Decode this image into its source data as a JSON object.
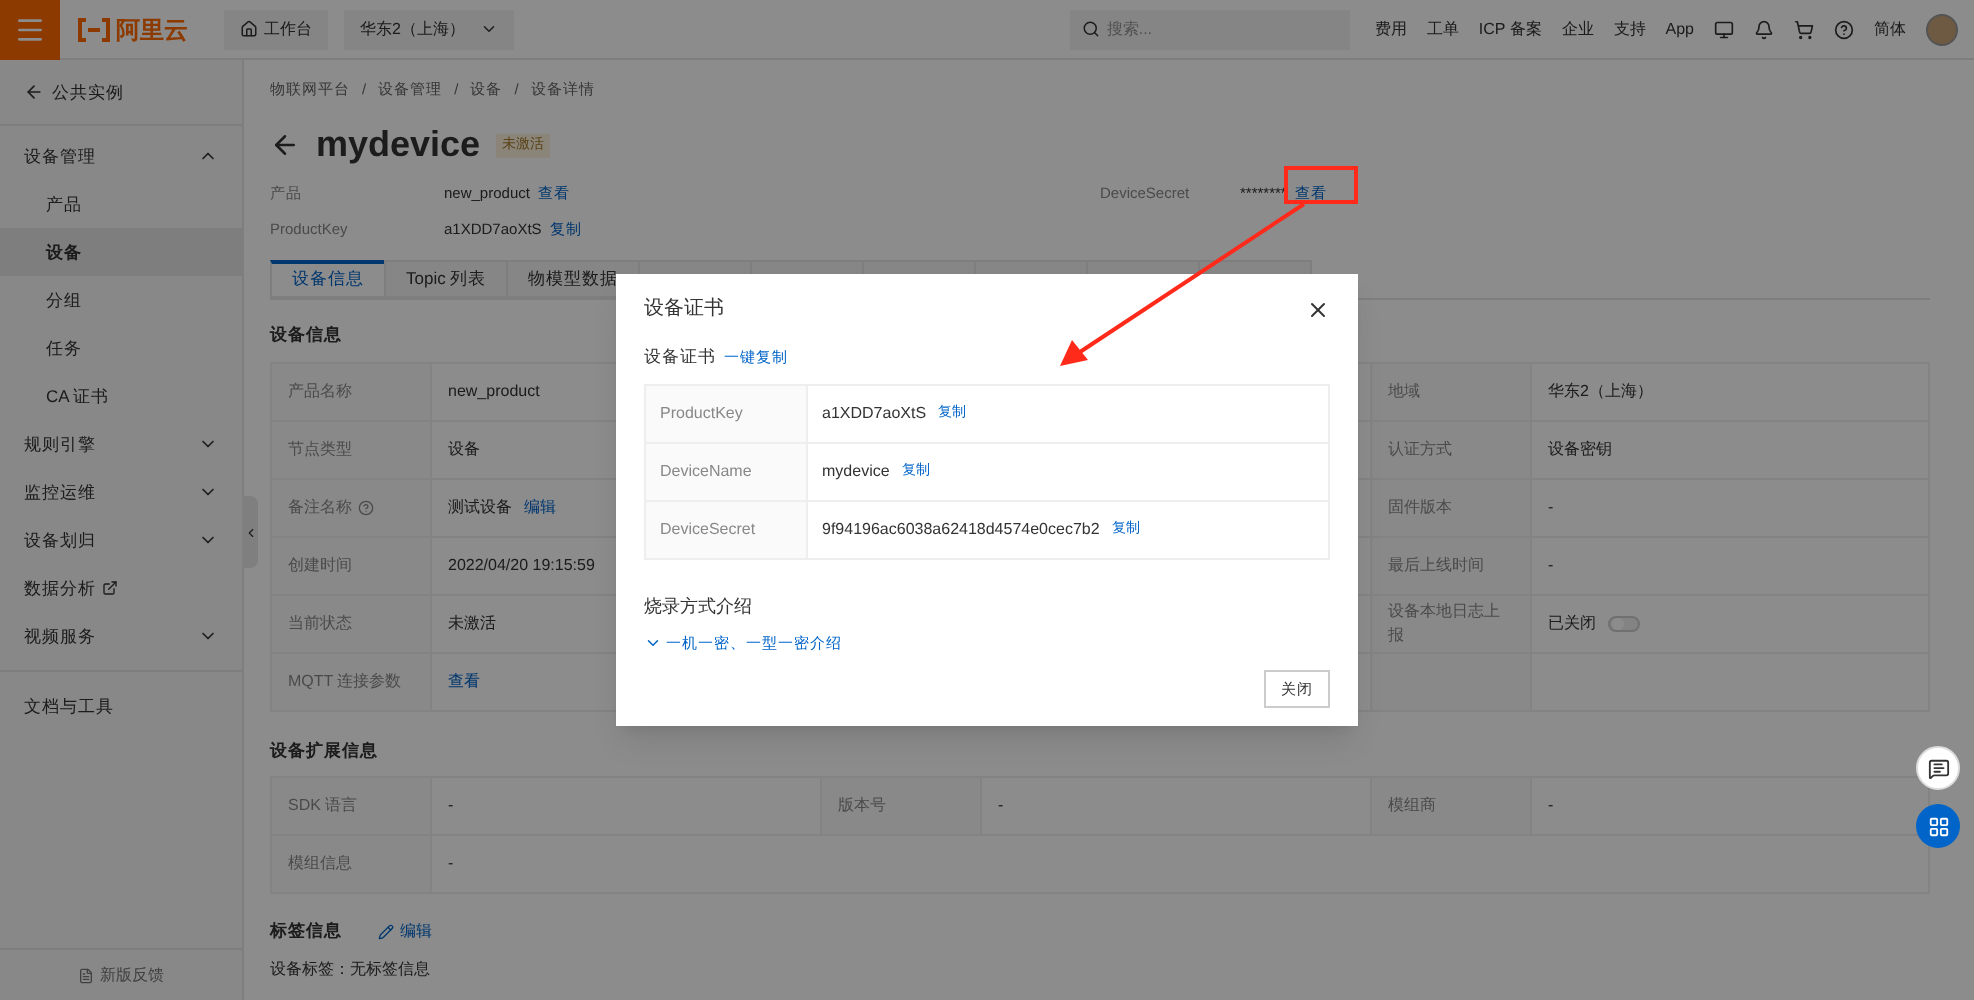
{
  "topbar": {
    "brand": "阿里云",
    "workbench": "工作台",
    "region": "华东2（上海）",
    "search": {
      "placeholder": "搜索..."
    },
    "links": [
      "费用",
      "工单",
      "ICP 备案",
      "企业",
      "支持",
      "App"
    ],
    "language": "简体"
  },
  "sidebar": {
    "back": "公共实例",
    "items": [
      {
        "label": "设备管理",
        "kind": "group",
        "expanded": true,
        "children": [
          {
            "label": "产品",
            "selected": false
          },
          {
            "label": "设备",
            "selected": true
          },
          {
            "label": "分组",
            "selected": false
          },
          {
            "label": "任务",
            "selected": false
          },
          {
            "label": "CA 证书",
            "selected": false
          }
        ]
      },
      {
        "label": "规则引擎",
        "kind": "group",
        "expanded": false
      },
      {
        "label": "监控运维",
        "kind": "group",
        "expanded": false
      },
      {
        "label": "设备划归",
        "kind": "group",
        "expanded": false
      },
      {
        "label": "数据分析",
        "kind": "external"
      },
      {
        "label": "视频服务",
        "kind": "group",
        "expanded": false
      },
      {
        "label": "文档与工具",
        "kind": "link"
      }
    ],
    "feedback": "新版反馈"
  },
  "breadcrumb": {
    "separator": "/",
    "items": [
      "物联网平台",
      "设备管理",
      "设备",
      "设备详情"
    ]
  },
  "device": {
    "name": "mydevice",
    "status": "未激活",
    "meta": [
      {
        "label": "产品",
        "value": "new_product",
        "action": "查看"
      },
      {
        "label": "ProductKey",
        "value": "a1XDD7aoXtS",
        "action": "复制"
      }
    ],
    "secret": {
      "label": "DeviceSecret",
      "value": "********",
      "action": "查看"
    }
  },
  "tabs": [
    {
      "label": "设备信息",
      "selected": true
    },
    {
      "label": "Topic 列表",
      "selected": false
    },
    {
      "label": "物模型数据",
      "selected": false
    },
    {
      "selected": false
    },
    {
      "selected": false
    },
    {
      "selected": false
    },
    {
      "selected": false
    },
    {
      "selected": false
    },
    {
      "selected": false
    }
  ],
  "info": {
    "title": "设备信息",
    "rows": [
      {
        "label": "产品名称",
        "value": "new_product",
        "right_label": "地域",
        "right_value": "华东2（上海）"
      },
      {
        "label": "节点类型",
        "value": "设备",
        "right_label": "认证方式",
        "right_value": "设备密钥"
      },
      {
        "label": "备注名称",
        "help": true,
        "value": "测试设备",
        "action": "编辑",
        "right_label": "固件版本",
        "right_value": "-"
      },
      {
        "label": "创建时间",
        "value": "2022/04/20 19:15:59",
        "right_label": "最后上线时间",
        "right_value": "-"
      },
      {
        "label": "当前状态",
        "value": "未激活",
        "right_label": "设备本地日志上报",
        "right_value": "已关闭",
        "switch_on": false
      },
      {
        "label": "MQTT 连接参数",
        "action": "查看"
      }
    ]
  },
  "extension": {
    "title": "设备扩展信息",
    "rows": [
      {
        "cells": [
          {
            "label": "SDK 语言",
            "value": "-"
          },
          {
            "label": "版本号",
            "value": "-"
          },
          {
            "label": "模组商",
            "value": "-"
          }
        ]
      },
      {
        "cells": [
          {
            "label": "模组信息",
            "value": "-"
          }
        ]
      }
    ]
  },
  "tags": {
    "title": "标签信息",
    "action": "编辑",
    "label": "设备标签：",
    "value": "无标签信息"
  },
  "modal": {
    "title": "设备证书",
    "subtitle": "设备证书",
    "copy_all": "一键复制",
    "rows": [
      {
        "key": "ProductKey",
        "value": "a1XDD7aoXtS",
        "action": "复制"
      },
      {
        "key": "DeviceName",
        "value": "mydevice",
        "action": "复制"
      },
      {
        "key": "DeviceSecret",
        "value": "9f94196ac6038a62418d4574e0cec7b2",
        "action": "复制"
      }
    ],
    "section": "烧录方式介绍",
    "expand_link": "一机一密、一型一密介绍",
    "close": "关闭"
  }
}
